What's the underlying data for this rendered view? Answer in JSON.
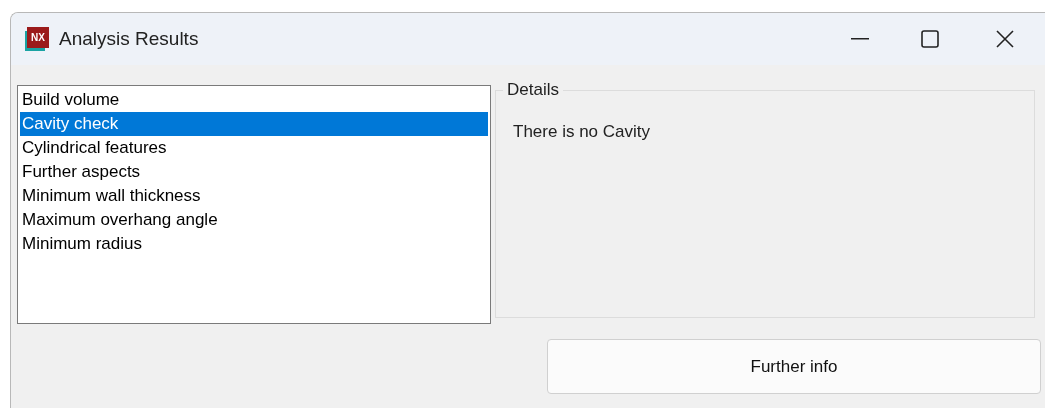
{
  "window": {
    "title": "Analysis Results",
    "icon_text": "NX"
  },
  "list": {
    "items": [
      {
        "label": "Build volume",
        "selected": false
      },
      {
        "label": "Cavity check",
        "selected": true
      },
      {
        "label": "Cylindrical features",
        "selected": false
      },
      {
        "label": "Further aspects",
        "selected": false
      },
      {
        "label": "Minimum wall thickness",
        "selected": false
      },
      {
        "label": "Maximum overhang angle",
        "selected": false
      },
      {
        "label": "Minimum radius",
        "selected": false
      }
    ]
  },
  "details": {
    "legend": "Details",
    "text": "There is no Cavity"
  },
  "buttons": [
    "Further info"
  ]
}
